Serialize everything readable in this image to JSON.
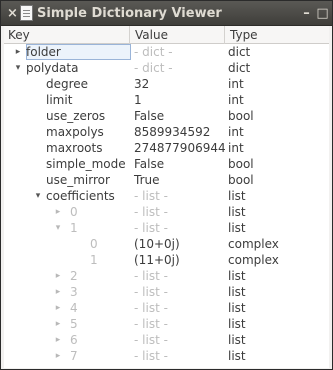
{
  "window": {
    "title": "Simple Dictionary Viewer",
    "buttons": {
      "close": "×",
      "minimize": "–",
      "maximize": "□"
    }
  },
  "columns": {
    "key": "Key",
    "value": "Value",
    "type": "Type"
  },
  "rows": [
    {
      "key": "folder",
      "value": "- dict -",
      "type": "dict",
      "expander": "▸",
      "dim": false,
      "selected": true
    },
    {
      "key": "polydata",
      "value": "- dict -",
      "type": "dict",
      "expander": "▾",
      "dim": false
    },
    {
      "key": "degree",
      "value": "32",
      "type": "int"
    },
    {
      "key": "limit",
      "value": "1",
      "type": "int"
    },
    {
      "key": "use_zeros",
      "value": "False",
      "type": "bool"
    },
    {
      "key": "maxpolys",
      "value": "8589934592",
      "type": "int"
    },
    {
      "key": "maxroots",
      "value": "274877906944",
      "type": "int"
    },
    {
      "key": "simple_mode",
      "value": "False",
      "type": "bool"
    },
    {
      "key": "use_mirror",
      "value": "True",
      "type": "bool"
    },
    {
      "key": "coefficients",
      "value": "- list -",
      "type": "list",
      "expander": "▾"
    },
    {
      "key": "0",
      "value": "- list -",
      "type": "list",
      "expander": "▸",
      "dimKey": true
    },
    {
      "key": "1",
      "value": "- list -",
      "type": "list",
      "expander": "▾",
      "dimKey": true
    },
    {
      "key": "0",
      "value": "(10+0j)",
      "type": "complex",
      "dimKey": true
    },
    {
      "key": "1",
      "value": "(11+0j)",
      "type": "complex",
      "dimKey": true
    },
    {
      "key": "2",
      "value": "- list -",
      "type": "list",
      "expander": "▸",
      "dimKey": true
    },
    {
      "key": "3",
      "value": "- list -",
      "type": "list",
      "expander": "▸",
      "dimKey": true
    },
    {
      "key": "4",
      "value": "- list -",
      "type": "list",
      "expander": "▸",
      "dimKey": true
    },
    {
      "key": "5",
      "value": "- list -",
      "type": "list",
      "expander": "▸",
      "dimKey": true
    },
    {
      "key": "6",
      "value": "- list -",
      "type": "list",
      "expander": "▸",
      "dimKey": true
    },
    {
      "key": "7",
      "value": "- list -",
      "type": "list",
      "expander": "▸",
      "dimKey": true
    }
  ]
}
